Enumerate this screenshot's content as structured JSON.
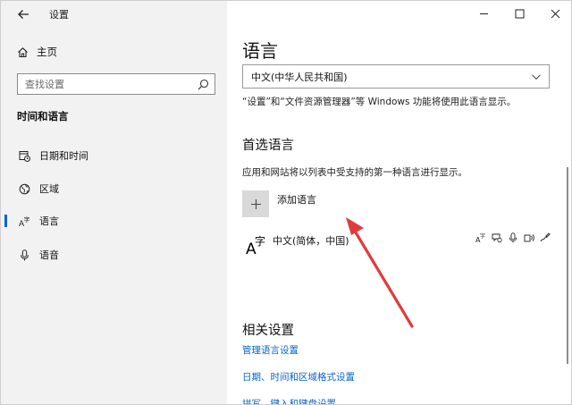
{
  "window": {
    "title": "设置"
  },
  "sidebar": {
    "home_label": "主页",
    "search_placeholder": "查找设置",
    "section_title": "时间和语言",
    "items": [
      {
        "label": "日期和时间",
        "icon": "calendar-clock-icon"
      },
      {
        "label": "区域",
        "icon": "globe-icon"
      },
      {
        "label": "语言",
        "icon": "language-icon",
        "active": true
      },
      {
        "label": "语音",
        "icon": "microphone-icon"
      }
    ]
  },
  "main": {
    "title": "语言",
    "display_language_value": "中文(中华人民共和国)",
    "display_language_note": "“设置”和“文件资源管理器”等 Windows 功能将使用此语言显示。",
    "preferred_title": "首选语言",
    "preferred_desc": "应用和网站将以列表中受支持的第一种语言进行显示。",
    "add_language_label": "添加语言",
    "languages": [
      {
        "glyph_a": "A",
        "glyph_z": "字",
        "name": "中文(简体，中国)"
      }
    ],
    "related_title": "相关设置",
    "links": [
      "管理语言设置",
      "日期、时间和区域格式设置",
      "拼写、键入和键盘设置"
    ]
  },
  "colors": {
    "accent": "#0a64c8",
    "annotation_arrow": "#e23b3b"
  }
}
